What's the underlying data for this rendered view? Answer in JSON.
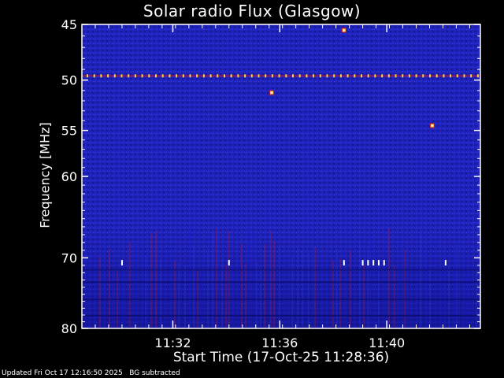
{
  "chart_data": {
    "type": "heatmap",
    "title": "Solar radio Flux (Glasgow)",
    "xlabel": "Start Time (17-Oct-25 11:28:36)",
    "ylabel": "Frequency [MHz]",
    "y_ticks": [
      45,
      50,
      55,
      60,
      70,
      80
    ],
    "y_scale": "log",
    "ylim": [
      45,
      80
    ],
    "x_ticks": [
      "11:32",
      "11:36",
      "11:40"
    ],
    "x_tick_minutes": [
      3.4,
      7.4,
      11.4
    ],
    "xlim_minutes": [
      0,
      14.9
    ],
    "colormap": [
      "#0a0a78",
      "#1a1ad8",
      "#c8141e",
      "#ffd24a",
      "#ffffff"
    ],
    "features": {
      "interference_band_mhz": 49.6,
      "hot_spots": [
        {
          "t_min": 9.8,
          "f_mhz": 45.5
        },
        {
          "t_min": 7.1,
          "f_mhz": 51.2
        },
        {
          "t_min": 13.1,
          "f_mhz": 54.5
        }
      ],
      "line_70mhz_markers_min": [
        1.5,
        5.5,
        9.8,
        10.5,
        10.7,
        10.9,
        11.1,
        11.3,
        13.6
      ]
    }
  },
  "footer": "Updated Fri Oct 17 12:16:50 2025   BG subtracted"
}
